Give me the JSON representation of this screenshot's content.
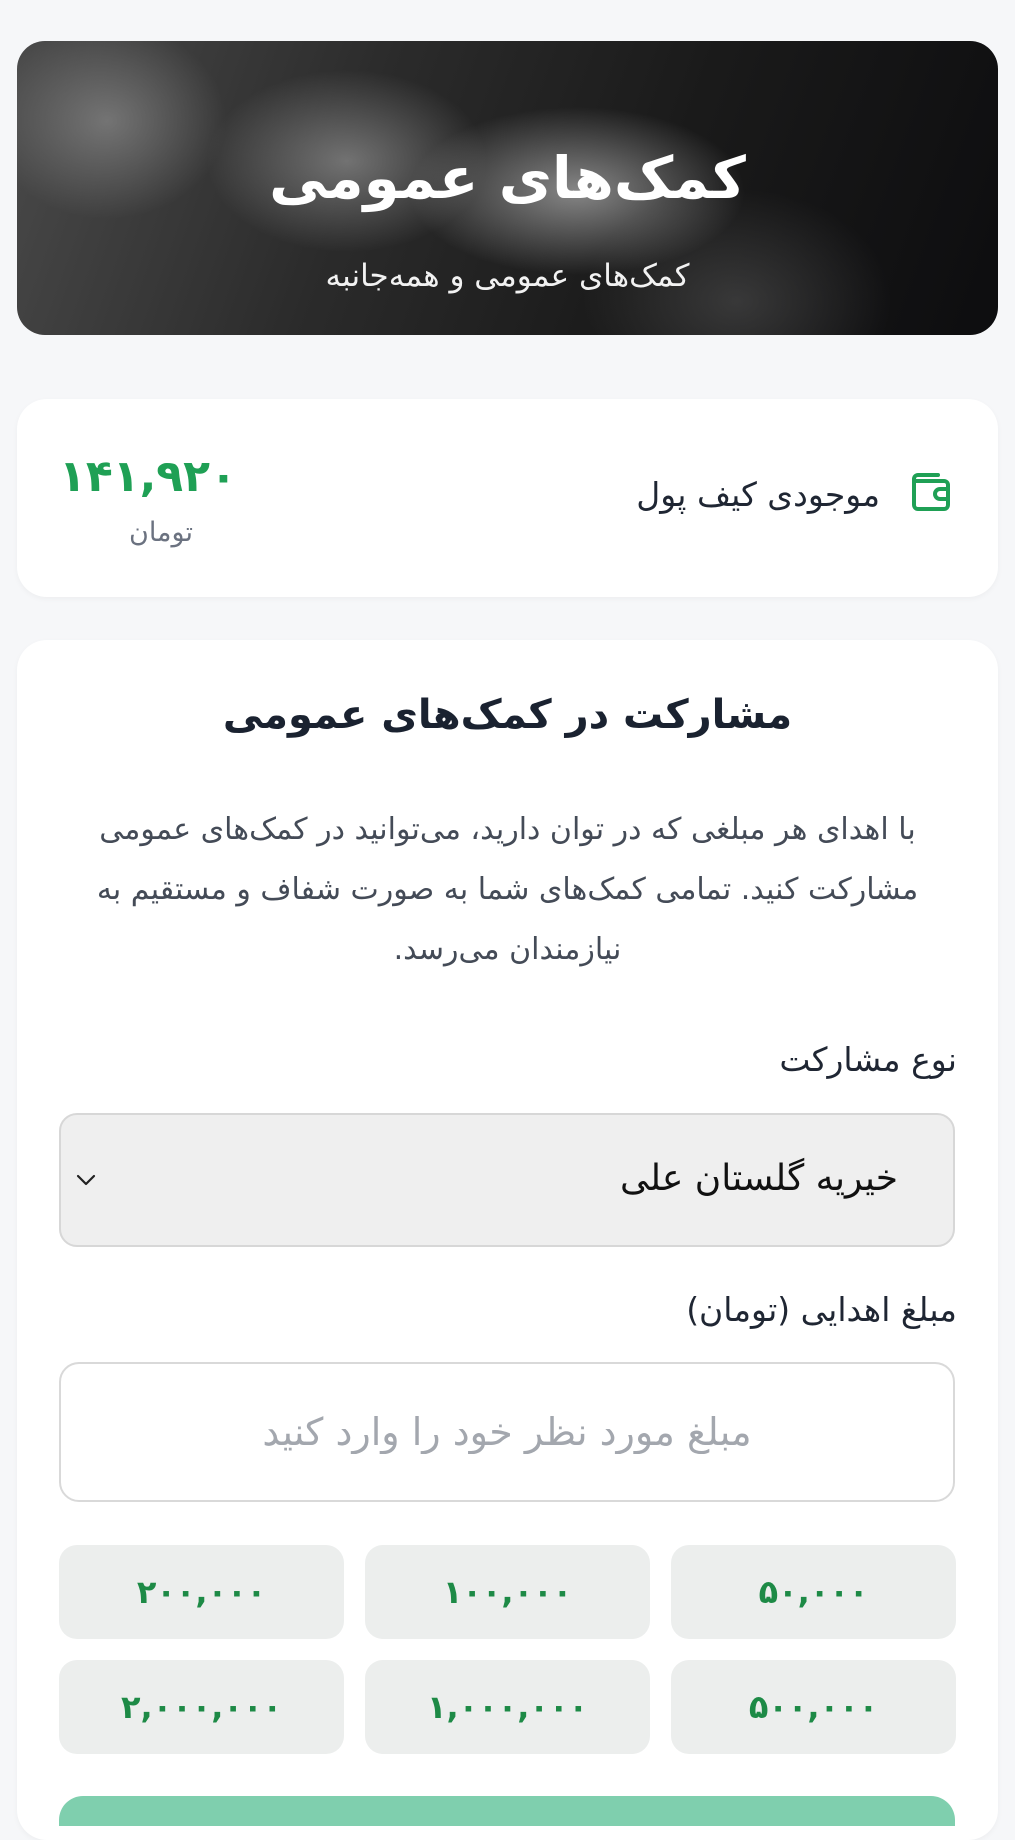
{
  "hero": {
    "title": "کمک‌های عمومی",
    "subtitle": "کمک‌های عمومی و همه‌جانبه"
  },
  "wallet": {
    "icon": "wallet-icon",
    "label": "موجودی کیف پول",
    "balance": "۱۴۱,۹۲۰",
    "unit": "تومان"
  },
  "form": {
    "title": "مشارکت در کمک‌های عمومی",
    "description": "با اهدای هر مبلغی که در توان دارید، می‌توانید در کمک‌های عمومی مشارکت کنید. تمامی کمک‌های شما به صورت شفاف و مستقیم به نیازمندان می‌رسد.",
    "type_label": "نوع مشارکت",
    "type_selected": "خیریه گلستان علی",
    "amount_label": "مبلغ اهدایی (تومان)",
    "amount_value": "",
    "amount_placeholder": "مبلغ مورد نظر خود را وارد کنید",
    "presets": [
      "۵۰,۰۰۰",
      "۱۰۰,۰۰۰",
      "۲۰۰,۰۰۰",
      "۵۰۰,۰۰۰",
      "۱,۰۰۰,۰۰۰",
      "۲,۰۰۰,۰۰۰"
    ]
  },
  "colors": {
    "accent_green": "#1fa055",
    "submit_green": "#7fcfae"
  }
}
